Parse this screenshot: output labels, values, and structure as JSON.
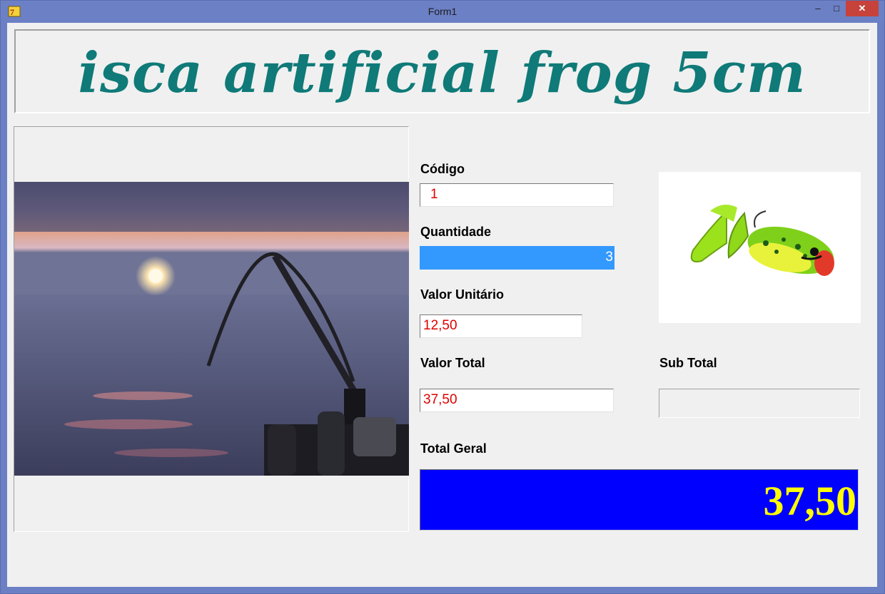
{
  "window": {
    "title": "Form1"
  },
  "banner": {
    "text": "isca artificial frog 5cm"
  },
  "form": {
    "codigo": {
      "label": "Código",
      "value": "1"
    },
    "quantidade": {
      "label": "Quantidade",
      "value": "3"
    },
    "valor_unitario": {
      "label": "Valor Unitário",
      "value": "12,50"
    },
    "valor_total": {
      "label": "Valor Total",
      "value": "37,50"
    },
    "sub_total": {
      "label": "Sub Total",
      "value": ""
    },
    "total_geral": {
      "label": "Total Geral",
      "value": "37,50"
    }
  },
  "colors": {
    "banner_text": "#0f7a78",
    "field_text": "#e00000",
    "grand_total_bg": "#0000ff",
    "grand_total_text": "#ffff00",
    "selection": "#3399ff"
  },
  "icons": [
    "app-icon",
    "minimize-icon",
    "maximize-icon",
    "close-icon"
  ]
}
